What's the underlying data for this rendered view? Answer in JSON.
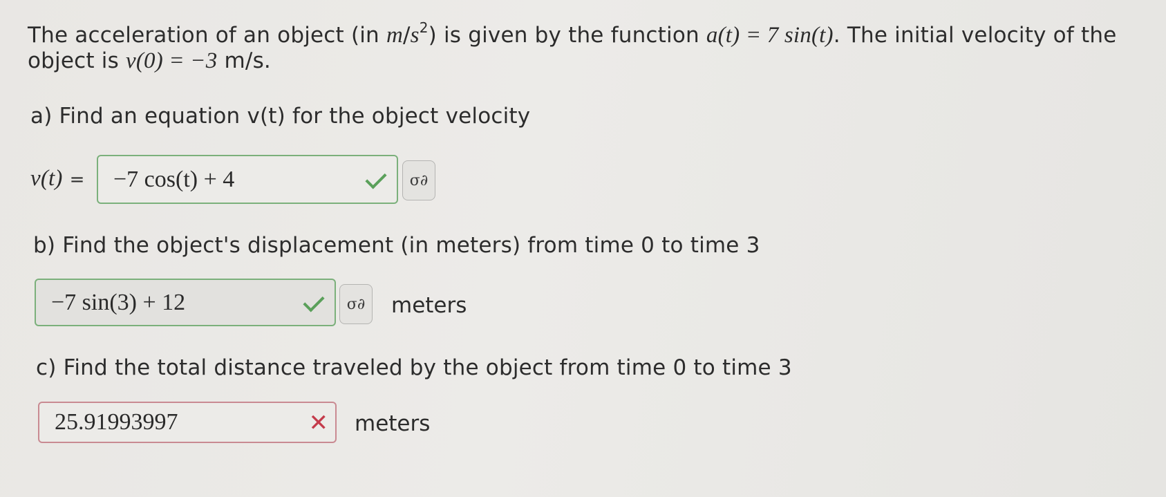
{
  "problem": {
    "intro_1a": "The acceleration of an object (in ",
    "unit_m": "m",
    "unit_slash": "/",
    "unit_s": "s",
    "unit_exp": "2",
    "intro_1b": ") is given by the function ",
    "accel_func": "a(t) = 7 sin(t)",
    "intro_1c": ". The initial velocity of the",
    "intro_2a": "object is ",
    "initial_vel": "v(0) = −3",
    "intro_2b": " m/s."
  },
  "part_a": {
    "question": "a) Find an equation v(t) for the object velocity",
    "lhs": "v(t)",
    "equals": "=",
    "answer": "−7 cos(t) + 4",
    "status": "correct",
    "keyboard_icon": "σ∂"
  },
  "part_b": {
    "question": "b) Find the object's displacement (in meters) from time 0 to time 3",
    "answer": "−7 sin(3) + 12",
    "status": "correct",
    "keyboard_icon": "σ∂",
    "unit": "meters"
  },
  "part_c": {
    "question": "c) Find the total distance traveled by the object from time 0 to time 3",
    "answer": "25.91993997",
    "status": "incorrect",
    "unit": "meters"
  },
  "colors": {
    "correct_border": "#7bb07b",
    "correct_check": "#5aa05a",
    "incorrect_border": "#c98a92",
    "incorrect_x": "#c43b4b"
  }
}
